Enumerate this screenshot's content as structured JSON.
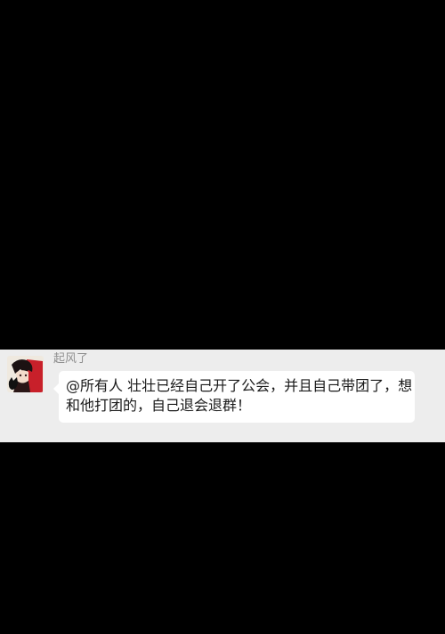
{
  "chat": {
    "sender_name": "起风了",
    "message": "@所有人 壮壮已经自己开了公会，并且自己带团了，想和他打团的，自己退会退群！",
    "next_sender_partial": "",
    "colors": {
      "background": "#000000",
      "chat_background": "#ededed",
      "bubble": "#ffffff",
      "sender_name": "#8f8f8f",
      "message_text": "#1a1a1a"
    },
    "avatar_icon": "anime-character-avatar-icon"
  }
}
